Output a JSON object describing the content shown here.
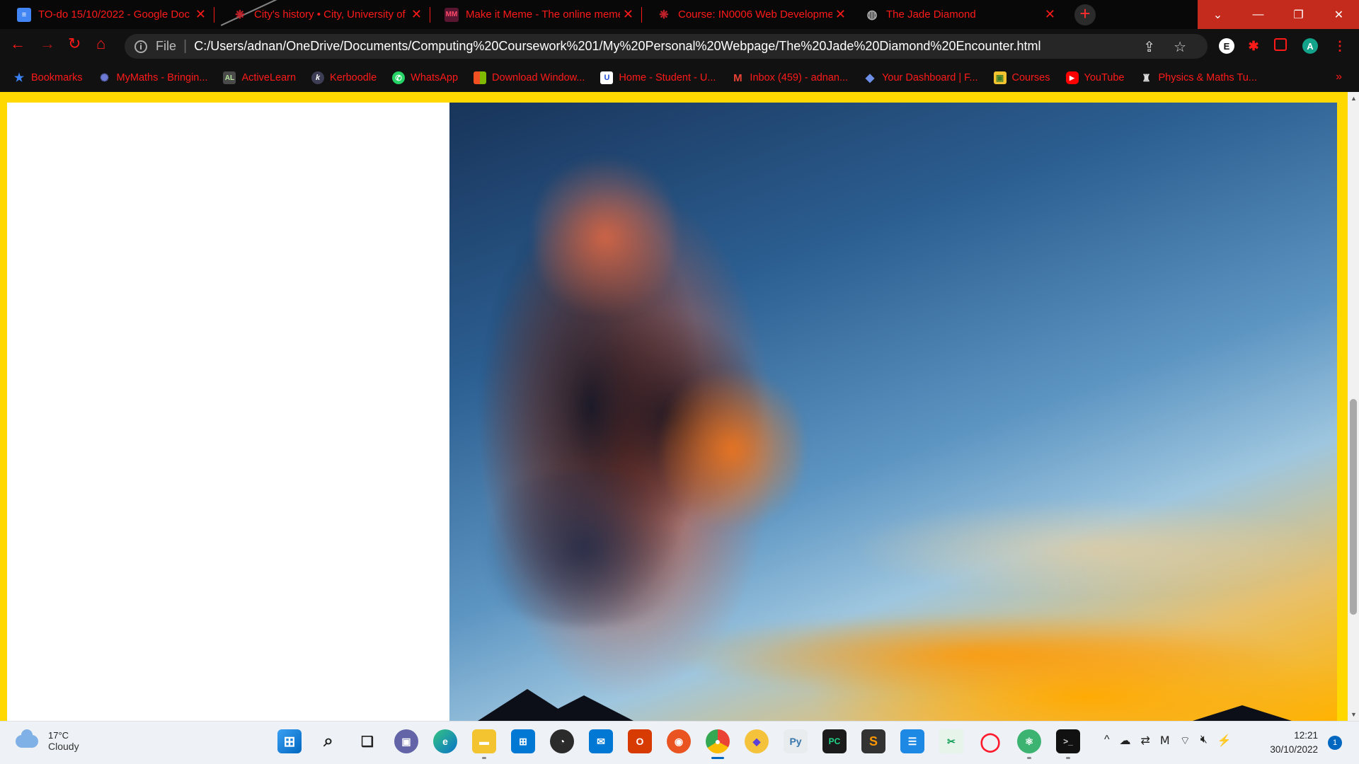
{
  "tabs": [
    {
      "title": "TO-do 15/10/2022 - Google Doc",
      "icon": "google-docs-icon"
    },
    {
      "title": "City's history • City, University of",
      "icon": "city-university-icon"
    },
    {
      "title": "Make it Meme - The online meme",
      "icon": "makeitmeme-icon",
      "favtext": "MM"
    },
    {
      "title": "Course: IN0006 Web Developme",
      "icon": "moodle-course-icon"
    },
    {
      "title": "The Jade Diamond",
      "icon": "globe-icon"
    }
  ],
  "address": {
    "scheme_label": "File",
    "url": "C:/Users/adnan/OneDrive/Documents/Computing%20Coursework%201/My%20Personal%20Webpage/The%20Jade%20Diamond%20Encounter.html"
  },
  "profile_initial": "A",
  "extension_initial": "E",
  "bookmarks": [
    {
      "label": "Bookmarks",
      "icon": "star-icon"
    },
    {
      "label": "MyMaths - Bringin...",
      "icon": "mymaths-icon"
    },
    {
      "label": "ActiveLearn",
      "icon": "activelearn-icon",
      "favtext": "AL"
    },
    {
      "label": "Kerboodle",
      "icon": "kerboodle-icon",
      "favtext": "k"
    },
    {
      "label": "WhatsApp",
      "icon": "whatsapp-icon"
    },
    {
      "label": "Download Window...",
      "icon": "windows-logo-icon"
    },
    {
      "label": "Home - Student - U...",
      "icon": "unidays-icon",
      "favtext": "U"
    },
    {
      "label": "Inbox (459) - adnan...",
      "icon": "gmail-icon",
      "favtext": "M"
    },
    {
      "label": "Your Dashboard | F...",
      "icon": "dashboard-diamond-icon"
    },
    {
      "label": "Courses",
      "icon": "courses-icon"
    },
    {
      "label": "YouTube",
      "icon": "youtube-icon"
    },
    {
      "label": "Physics & Maths Tu...",
      "icon": "pmt-icon"
    }
  ],
  "weather": {
    "temp": "17°C",
    "condition": "Cloudy"
  },
  "clock": {
    "time": "12:21",
    "date": "30/10/2022"
  },
  "notification_count": "1",
  "colors": {
    "accent": "#ff1a1a",
    "page_border": "#ffd800",
    "close_button": "#c42b1c"
  }
}
